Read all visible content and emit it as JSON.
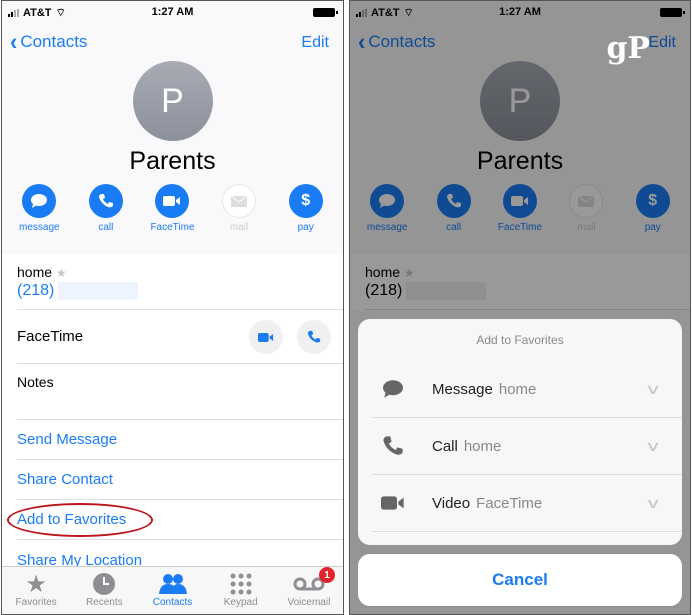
{
  "status": {
    "carrier": "AT&T",
    "time": "1:27 AM"
  },
  "nav": {
    "back_label": "Contacts",
    "edit_label": "Edit"
  },
  "contact": {
    "initial": "P",
    "name": "Parents"
  },
  "actions": [
    {
      "label": "message",
      "icon": "message-icon",
      "enabled": true
    },
    {
      "label": "call",
      "icon": "phone-icon",
      "enabled": true
    },
    {
      "label": "FaceTime",
      "icon": "video-icon",
      "enabled": true
    },
    {
      "label": "mail",
      "icon": "mail-icon",
      "enabled": false
    },
    {
      "label": "pay",
      "icon": "dollar-icon",
      "enabled": true
    }
  ],
  "phone": {
    "label": "home",
    "number_prefix": "(218)"
  },
  "facetime_label": "FaceTime",
  "notes_label": "Notes",
  "links": [
    "Send Message",
    "Share Contact",
    "Add to Favorites",
    "Share My Location"
  ],
  "tabs": [
    {
      "label": "Favorites",
      "active": false
    },
    {
      "label": "Recents",
      "active": false
    },
    {
      "label": "Contacts",
      "active": true
    },
    {
      "label": "Keypad",
      "active": false
    },
    {
      "label": "Voicemail",
      "active": false,
      "badge": "1"
    }
  ],
  "watermark": "gP",
  "sheet": {
    "title": "Add to Favorites",
    "options": [
      {
        "label": "Message",
        "sub": "home",
        "icon": "message-icon"
      },
      {
        "label": "Call",
        "sub": "home",
        "icon": "phone-icon"
      },
      {
        "label": "Video",
        "sub": "FaceTime",
        "icon": "video-icon"
      }
    ],
    "cancel_label": "Cancel"
  },
  "colors": {
    "accent": "#1a7cf5",
    "highlight": "#c0141c",
    "badge": "#e0242b"
  }
}
